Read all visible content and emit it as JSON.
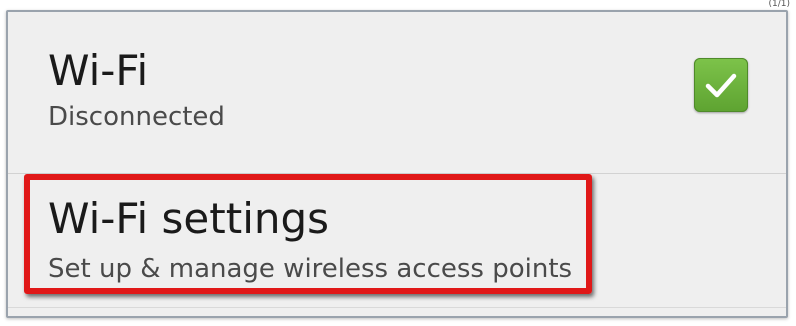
{
  "corner_text": "(1/1)",
  "settings_list": {
    "wifi": {
      "title": "Wi-Fi",
      "status": "Disconnected",
      "checked": true,
      "check_color": "#6cb33e"
    },
    "wifi_settings": {
      "title": "Wi-Fi settings",
      "description": "Set up & manage wireless access points"
    }
  },
  "highlight": {
    "color": "#e01818"
  },
  "icons": {
    "checkbox": "checkmark-icon"
  }
}
